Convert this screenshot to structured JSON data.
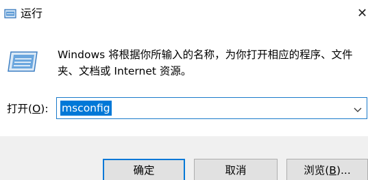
{
  "window": {
    "title": "运行"
  },
  "description": {
    "line1": "Windows 将根据你所输入的名称，为你打开相应的程序、文件",
    "line2": "夹、文档或 Internet 资源。"
  },
  "open_field": {
    "label_prefix": "打开(",
    "label_key": "O",
    "label_suffix": "):",
    "value": "msconfig"
  },
  "buttons": {
    "ok": "确定",
    "cancel": "取消",
    "browse_prefix": "浏览(",
    "browse_key": "B",
    "browse_suffix": ")..."
  },
  "icons": {
    "title": "run-icon",
    "main": "run-icon",
    "close": "close-icon",
    "dropdown": "chevron-down-icon"
  },
  "colors": {
    "selection": "#0078d7",
    "focus_border": "#1979ca"
  }
}
